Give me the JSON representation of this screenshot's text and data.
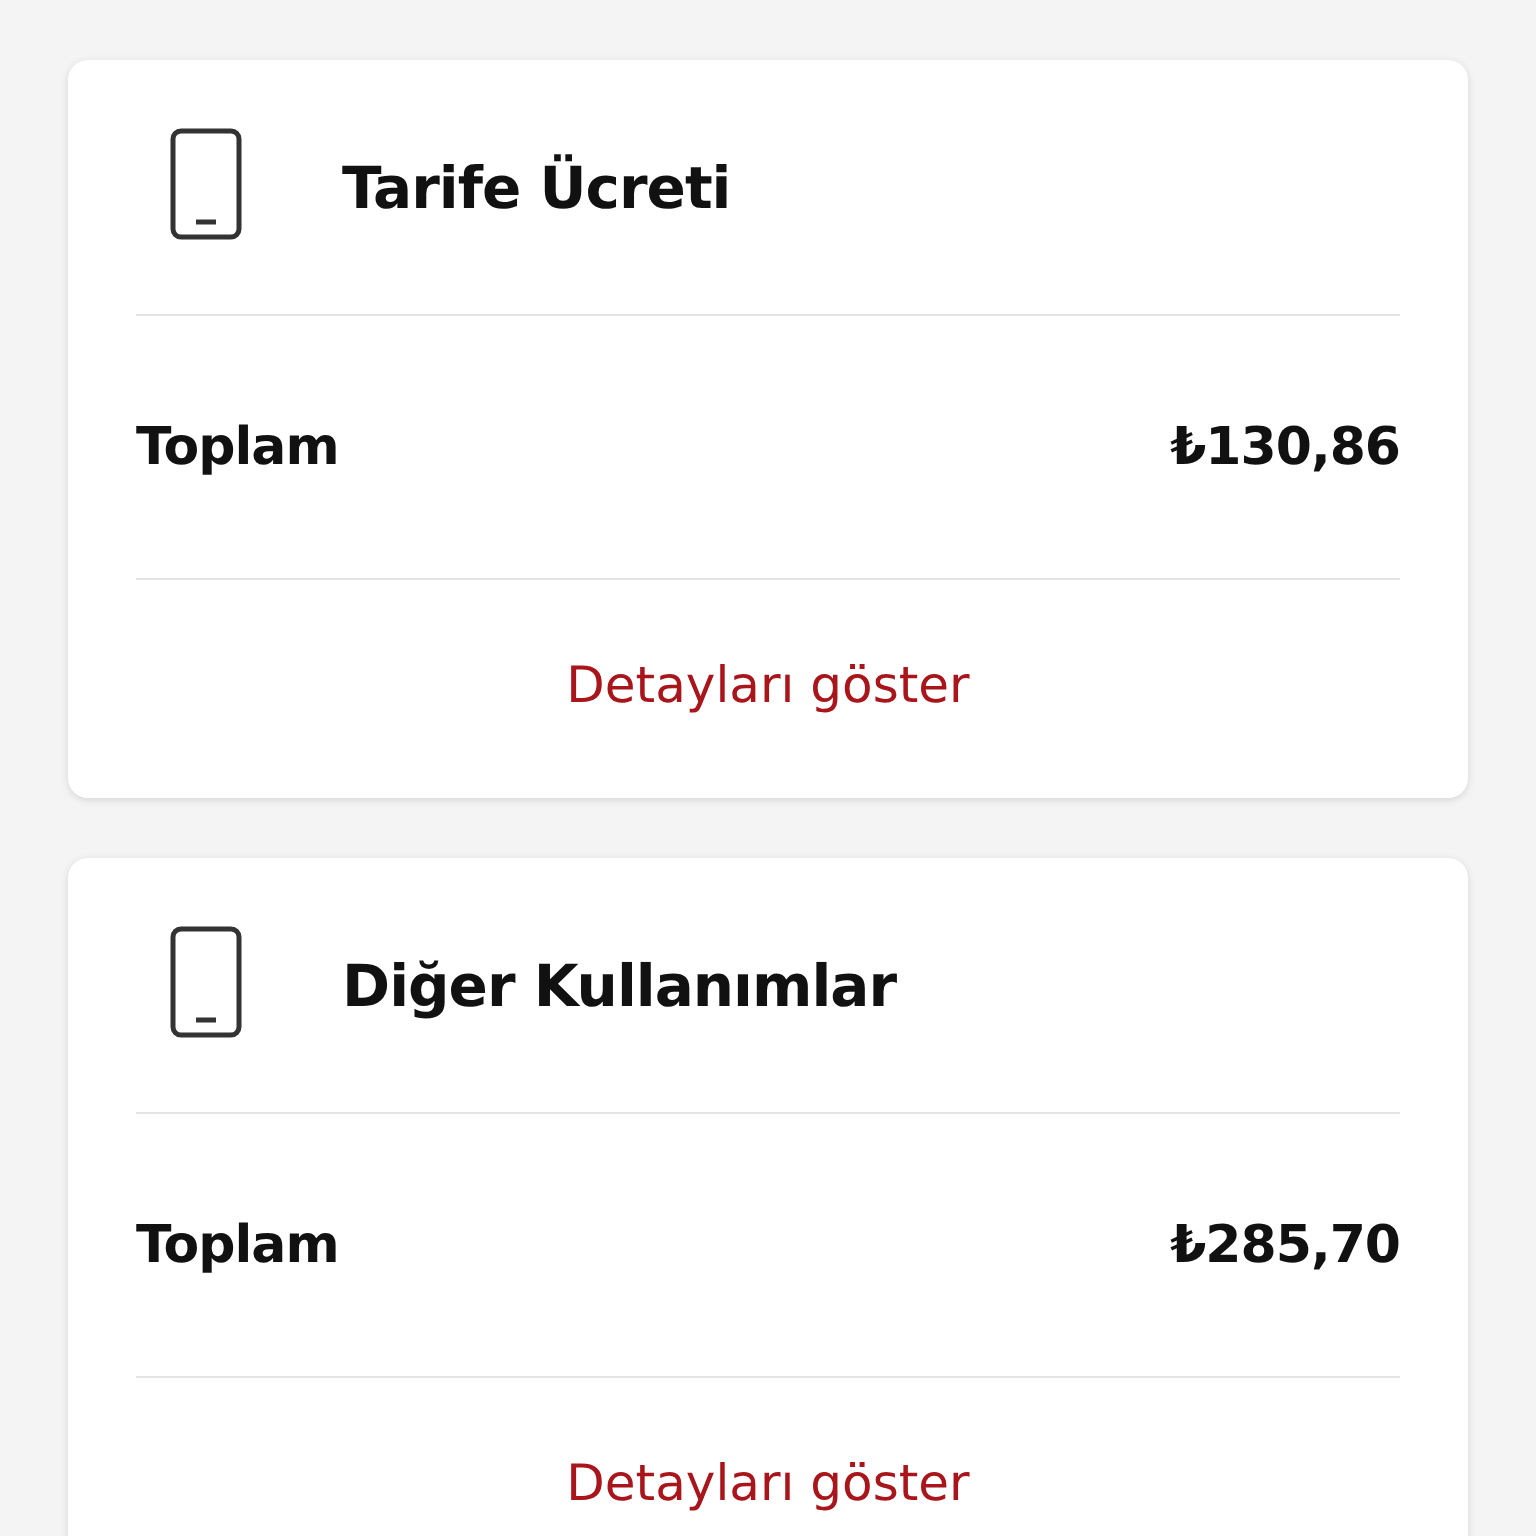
{
  "cards": [
    {
      "title": "Tarife Ücreti",
      "total_label": "Toplam",
      "total_value": "₺130,86",
      "link": "Detayları göster"
    },
    {
      "title": "Diğer Kullanımlar",
      "total_label": "Toplam",
      "total_value": "₺285,70",
      "link": "Detayları göster"
    }
  ]
}
